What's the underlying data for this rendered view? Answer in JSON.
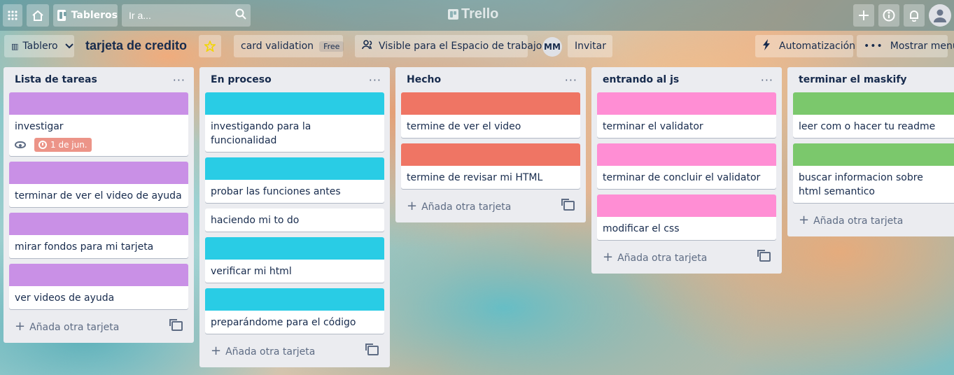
{
  "topbar": {
    "boards_label": "Tableros",
    "search_placeholder": "Ir a...",
    "logo": "Trello"
  },
  "boardbar": {
    "view_label": "Tablero",
    "title": "tarjeta de credito",
    "workspace_name": "card validation",
    "workspace_badge": "Free",
    "visibility_label": "Visible para el Espacio de trabajo",
    "avatar_initials": "MM",
    "invite_label": "Invitar",
    "automation_label": "Automatización",
    "menu_label": "Mostrar menú"
  },
  "colors": {
    "purple": "#c990e6",
    "cyan": "#29cce5",
    "red": "#ef7564",
    "pink": "#ff8ed4",
    "green": "#7bc86c",
    "due_badge": "#ec9488"
  },
  "lists": [
    {
      "title": "Lista de tareas",
      "add_label": "Añada otra tarjeta",
      "cards": [
        {
          "title": "investigar",
          "cover": "purple",
          "due": "1 de jun."
        },
        {
          "title": "terminar de ver el video de ayuda",
          "cover": "purple"
        },
        {
          "title": "mirar fondos para mi tarjeta",
          "cover": "purple"
        },
        {
          "title": "ver videos de ayuda",
          "cover": "purple"
        }
      ]
    },
    {
      "title": "En proceso",
      "add_label": "Añada otra tarjeta",
      "cards": [
        {
          "title": "investigando para la funcionalidad",
          "cover": "cyan"
        },
        {
          "title": "probar las funciones antes",
          "cover": "cyan"
        },
        {
          "title": "haciendo mi to do",
          "cover": ""
        },
        {
          "title": "verificar mi html",
          "cover": "cyan"
        },
        {
          "title": "preparándome para el código",
          "cover": "cyan"
        }
      ]
    },
    {
      "title": "Hecho",
      "add_label": "Añada otra tarjeta",
      "cards": [
        {
          "title": "termine de ver el video",
          "cover": "red"
        },
        {
          "title": "termine de revisar mi HTML",
          "cover": "red"
        }
      ]
    },
    {
      "title": "entrando al js",
      "add_label": "Añada otra tarjeta",
      "cards": [
        {
          "title": "terminar el validator",
          "cover": "pink"
        },
        {
          "title": "terminar de concluir el validator",
          "cover": "pink"
        },
        {
          "title": "modificar el css",
          "cover": "pink"
        }
      ]
    },
    {
      "title": "terminar el maskify",
      "add_label": "Añada otra tarjeta",
      "cards": [
        {
          "title": "leer com o hacer tu readme",
          "cover": "green"
        },
        {
          "title": "buscar informacion sobre html semantico",
          "cover": "green"
        }
      ]
    }
  ]
}
